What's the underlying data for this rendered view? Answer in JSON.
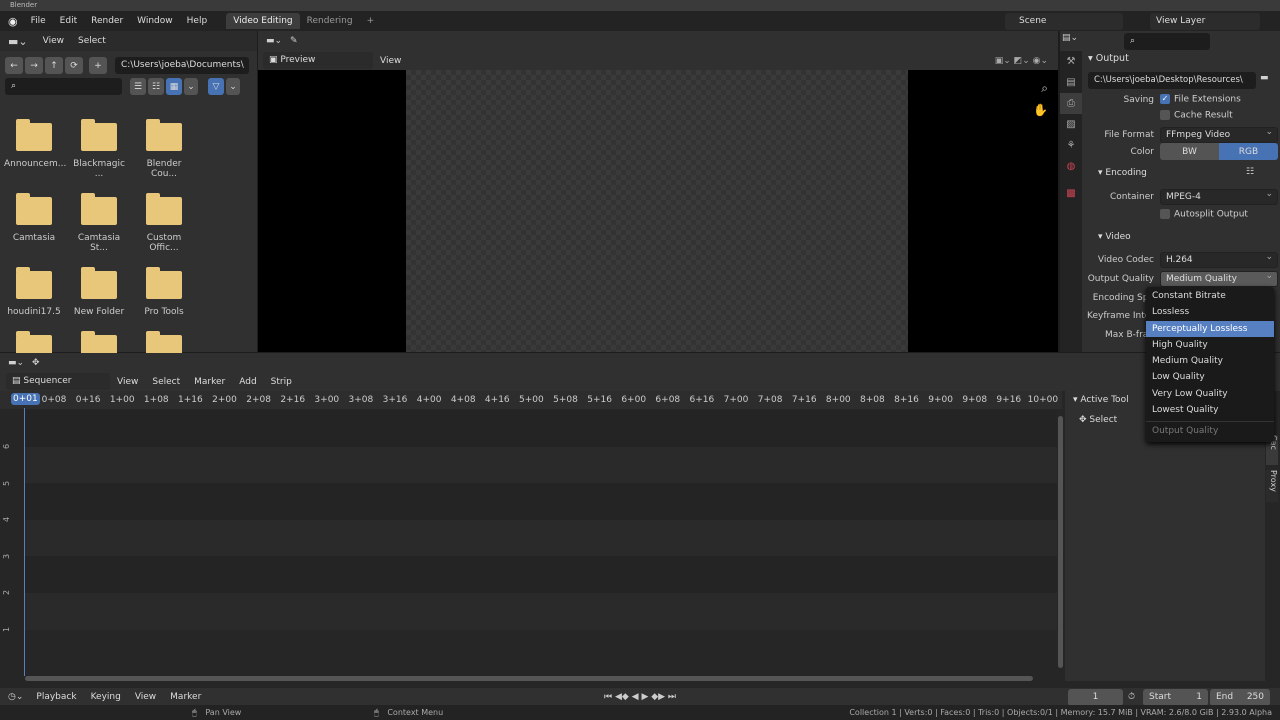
{
  "window": {
    "title": "Blender"
  },
  "topbar": {
    "menus": [
      "File",
      "Edit",
      "Render",
      "Window",
      "Help"
    ],
    "workspaces": [
      "Video Editing",
      "Rendering"
    ],
    "add": "+",
    "scene": "Scene",
    "view_layer": "View Layer"
  },
  "file_browser": {
    "menus": [
      "View",
      "Select"
    ],
    "path": "C:\\Users\\joeba\\Documents\\",
    "search_placeholder": "",
    "folders": [
      "Announcem...",
      "Blackmagic ...",
      "Blender Cou...",
      "Camtasia",
      "Camtasia St...",
      "Custom Offic...",
      "houdini17.5",
      "New Folder",
      "Pro Tools",
      "",
      "",
      ""
    ]
  },
  "preview": {
    "mode": "Preview",
    "view": "View"
  },
  "properties": {
    "section": "Output",
    "path": "C:\\Users\\joeba\\Desktop\\Resources\\",
    "saving_label": "Saving",
    "file_extensions": "File Extensions",
    "file_extensions_checked": true,
    "cache_result": "Cache Result",
    "cache_result_checked": false,
    "file_format_label": "File Format",
    "file_format": "FFmpeg Video",
    "color_label": "Color",
    "color_options": [
      "BW",
      "RGB"
    ],
    "color_selected": "RGB",
    "encoding": "Encoding",
    "container_label": "Container",
    "container": "MPEG-4",
    "autosplit": "Autosplit Output",
    "video": "Video",
    "video_codec_label": "Video Codec",
    "video_codec": "H.264",
    "output_quality_label": "Output Quality",
    "output_quality": "Medium Quality",
    "encoding_speed_label": "Encoding Spe",
    "keyframe_label": "Keyframe Inter",
    "bframes_label": "Max B-fran"
  },
  "quality_menu": {
    "items": [
      "Constant Bitrate",
      "Lossless",
      "Perceptually Lossless",
      "High Quality",
      "Medium Quality",
      "Low Quality",
      "Very Low Quality",
      "Lowest Quality"
    ],
    "highlighted": "Perceptually Lossless",
    "title": "Output Quality"
  },
  "sequencer": {
    "editor": "Sequencer",
    "menus": [
      "View",
      "Select",
      "Marker",
      "Add",
      "Strip"
    ],
    "current_frame": "0+01",
    "ticks": [
      "0+08",
      "0+16",
      "1+00",
      "1+08",
      "1+16",
      "2+00",
      "2+08",
      "2+16",
      "3+00",
      "3+08",
      "3+16",
      "4+00",
      "4+08",
      "4+16",
      "5+00",
      "5+08",
      "5+16",
      "6+00",
      "6+08",
      "6+16",
      "7+00",
      "7+08",
      "7+16",
      "8+00",
      "8+08",
      "8+16",
      "9+00",
      "9+08",
      "9+16",
      "10+00"
    ],
    "channels": [
      "6",
      "5",
      "4",
      "3",
      "2",
      "1"
    ],
    "sidebar_title": "Active Tool",
    "tool": "Select",
    "side_tabs": [
      "Cac",
      "Proxy"
    ]
  },
  "timeline": {
    "menus": [
      "Playback",
      "Keying",
      "View",
      "Marker"
    ],
    "frame": "1",
    "start_label": "Start",
    "start": "1",
    "end_label": "End",
    "end": "250"
  },
  "statusbar": {
    "pan": "Pan View",
    "context": "Context Menu",
    "stats": "Collection 1 | Verts:0 | Faces:0 | Tris:0 | Objects:0/1 | Memory: 15.7 MiB | VRAM: 2.6/8.0 GiB | 2.93.0 Alpha"
  },
  "colors": {
    "accent": "#4772b3",
    "highlight": "#5680c2",
    "folder": "#e8c77a",
    "playhead": "#5680c2"
  }
}
